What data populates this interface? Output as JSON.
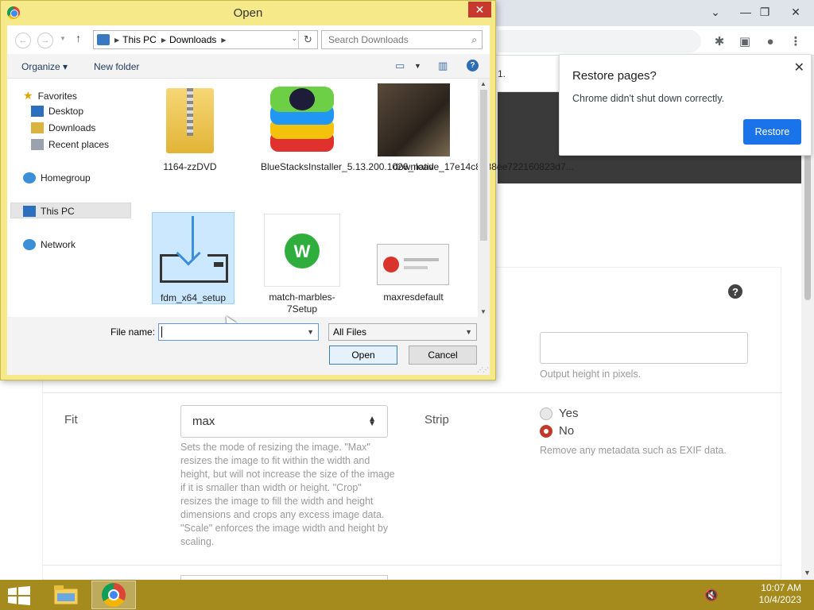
{
  "chrome": {
    "page_tab_text": "1.",
    "restore": {
      "title": "Restore pages?",
      "message": "Chrome didn't shut down correctly.",
      "button": "Restore",
      "close": "✕"
    },
    "form": {
      "help_icon": "?",
      "height_help": "Output height in pixels.",
      "fit_label": "Fit",
      "fit_value": "max",
      "fit_help": "Sets the mode of resizing the image. \"Max\" resizes the image to fit within the width and height, but will not increase the size of the image if it is smaller than width or height. \"Crop\" resizes the image to fill the width and height dimensions and crops any excess image data. \"Scale\" enforces the image width and height by scaling.",
      "strip_label": "Strip",
      "strip_options": [
        {
          "label": "Yes",
          "checked": false
        },
        {
          "label": "No",
          "checked": true
        }
      ],
      "strip_help": "Remove any metadata such as EXIF data.",
      "accent_color": "#c0392b"
    }
  },
  "dialog": {
    "title": "Open",
    "close": "✕",
    "path": [
      "This PC",
      "Downloads"
    ],
    "search_placeholder": "Search Downloads",
    "organize": "Organize ▾",
    "new_folder": "New folder",
    "nav": {
      "favorites": "Favorites",
      "desktop": "Desktop",
      "downloads": "Downloads",
      "recent": "Recent places",
      "homegroup": "Homegroup",
      "thispc": "This PC",
      "network": "Network"
    },
    "files": [
      {
        "name": "1164-zzDVD",
        "icon": "zip-folder-icon"
      },
      {
        "name": "BlueStacksInstaller_5.13.200.1026_native_17e14c8288ee722160823d7...",
        "icon": "bluestacks-icon"
      },
      {
        "name": "download",
        "icon": "photo-thumbnail"
      },
      {
        "name": "fdm_x64_setup",
        "icon": "download-installer-icon",
        "selected": true
      },
      {
        "name": "match-marbles-7Setup",
        "icon": "setup-icon"
      },
      {
        "name": "maxresdefault",
        "icon": "screenshot-thumbnail"
      }
    ],
    "file_name_label": "File name:",
    "file_name_value": "",
    "file_type": "All Files",
    "open_button": "Open",
    "cancel_button": "Cancel"
  },
  "taskbar": {
    "time": "10:07 AM",
    "date": "10/4/2023",
    "color": "#a58a1e"
  }
}
